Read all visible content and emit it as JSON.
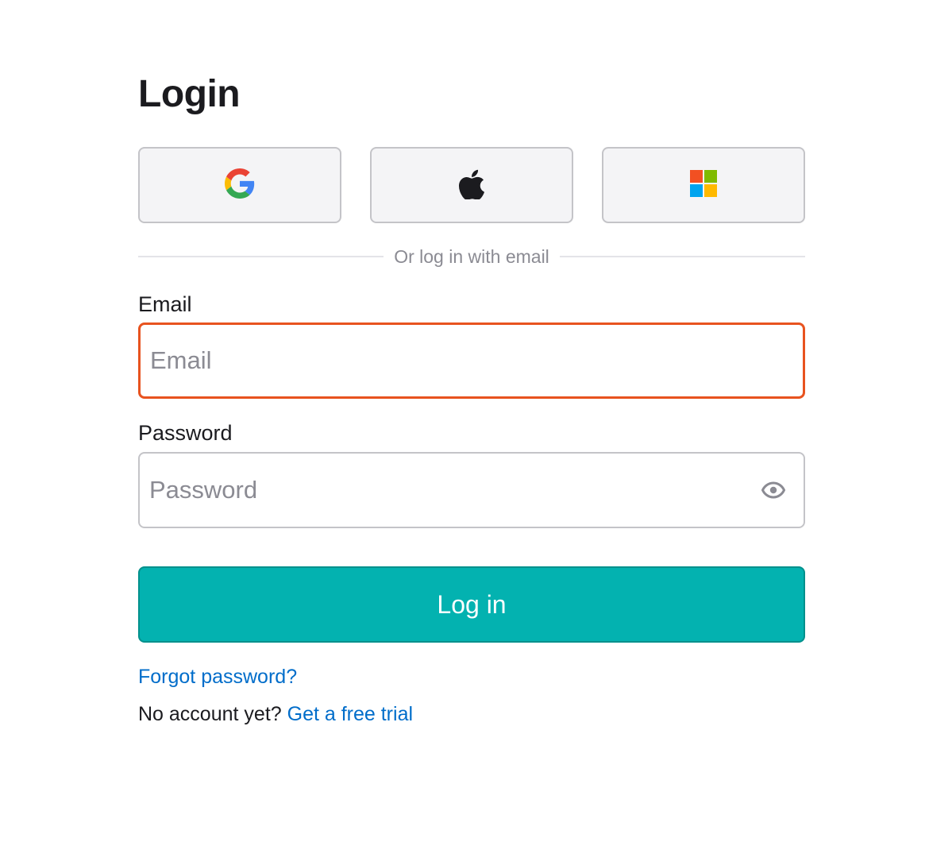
{
  "form": {
    "title": "Login",
    "sso_providers": [
      {
        "id": "google",
        "icon": "google-icon"
      },
      {
        "id": "apple",
        "icon": "apple-icon"
      },
      {
        "id": "microsoft",
        "icon": "microsoft-icon"
      }
    ],
    "divider_text": "Or log in with email",
    "email": {
      "label": "Email",
      "placeholder": "Email",
      "value": "",
      "state": "invalid",
      "border_color": "#e8531f"
    },
    "password": {
      "label": "Password",
      "placeholder": "Password",
      "value": "",
      "toggle_icon": "eye-icon"
    },
    "submit_label": "Log in",
    "forgot_password_link": "Forgot password?",
    "signup_prompt": "No account yet?",
    "signup_link": "Get a free trial"
  },
  "colors": {
    "primary": "#03b2b0",
    "link": "#006dca",
    "error": "#e8531f",
    "muted_text": "#8b8b93",
    "sso_background": "#f4f4f6"
  }
}
